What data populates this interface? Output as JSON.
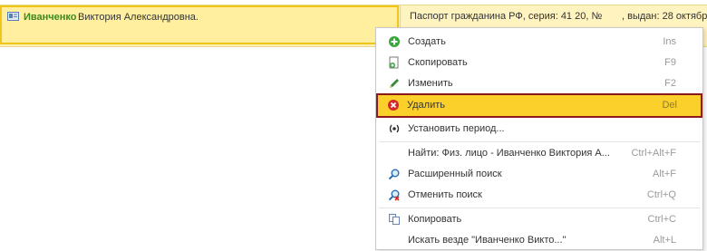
{
  "row": {
    "icon": "id-card-icon",
    "surname": "Иванченко",
    "given_names": "Виктория Александровна.",
    "document": "Паспорт гражданина РФ, серия: 41 20, №",
    "issued": ", выдан: 28 октября"
  },
  "menu": {
    "items": [
      {
        "icon": "plus-circle-icon",
        "label": "Создать",
        "shortcut": "Ins"
      },
      {
        "icon": "copy-document-icon",
        "label": "Скопировать",
        "shortcut": "F9"
      },
      {
        "icon": "pencil-icon",
        "label": "Изменить",
        "shortcut": "F2"
      },
      {
        "icon": "delete-circle-icon",
        "label": "Удалить",
        "shortcut": "Del"
      },
      {
        "icon": "period-icon",
        "label": "Установить период...",
        "shortcut": ""
      },
      {
        "icon": "",
        "label": "Найти: Физ. лицо - Иванченко Виктория А...",
        "shortcut": "Ctrl+Alt+F"
      },
      {
        "icon": "search-magnifier-icon",
        "label": "Расширенный поиск",
        "shortcut": "Alt+F"
      },
      {
        "icon": "cancel-search-icon",
        "label": "Отменить поиск",
        "shortcut": "Ctrl+Q"
      },
      {
        "icon": "copy-icon",
        "label": "Копировать",
        "shortcut": "Ctrl+C"
      },
      {
        "icon": "",
        "label": "Искать везде \"Иванченко Викто...\"",
        "shortcut": "Alt+L"
      }
    ]
  },
  "colors": {
    "row_bg": "#fff1b3",
    "highlight": "#fcd02a",
    "highlight_border": "#8b1a1a",
    "surname": "#3a8a1e"
  }
}
